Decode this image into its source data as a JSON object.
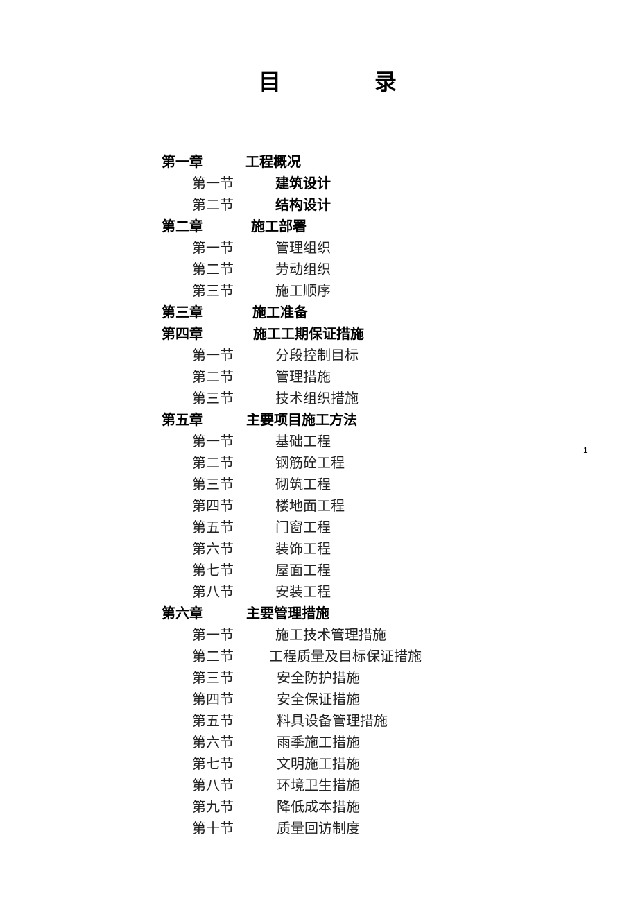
{
  "title": {
    "char1": "目",
    "char2": "录"
  },
  "page_number": "1",
  "toc": [
    {
      "type": "chapter",
      "label": "第一章",
      "title": "工程概况"
    },
    {
      "type": "section",
      "label": "第一节",
      "title": "建筑设计",
      "bold": true
    },
    {
      "type": "section",
      "label": "第二节",
      "title": "结构设计",
      "bold": true
    },
    {
      "type": "chapter",
      "label": "第二章",
      "title": "施工部署"
    },
    {
      "type": "section",
      "label": "第一节",
      "title": "管理组织"
    },
    {
      "type": "section",
      "label": "第二节",
      "title": "劳动组织"
    },
    {
      "type": "section",
      "label": "第三节",
      "title": "施工顺序"
    },
    {
      "type": "chapter",
      "label": "第三章",
      "title": "施工准备"
    },
    {
      "type": "chapter",
      "label": "第四章",
      "title": "施工工期保证措施"
    },
    {
      "type": "section",
      "label": "第一节",
      "title": "分段控制目标"
    },
    {
      "type": "section",
      "label": "第二节",
      "title": "管理措施"
    },
    {
      "type": "section",
      "label": "第三节",
      "title": "技术组织措施"
    },
    {
      "type": "chapter",
      "label": "第五章",
      "title": "主要项目施工方法"
    },
    {
      "type": "section",
      "label": "第一节",
      "title": "基础工程"
    },
    {
      "type": "section",
      "label": "第二节",
      "title": "钢筋砼工程"
    },
    {
      "type": "section",
      "label": "第三节",
      "title": "砌筑工程"
    },
    {
      "type": "section",
      "label": "第四节",
      "title": "楼地面工程"
    },
    {
      "type": "section",
      "label": "第五节",
      "title": "门窗工程"
    },
    {
      "type": "section",
      "label": "第六节",
      "title": "装饰工程"
    },
    {
      "type": "section",
      "label": "第七节",
      "title": "屋面工程"
    },
    {
      "type": "section",
      "label": "第八节",
      "title": "安装工程"
    },
    {
      "type": "chapter",
      "label": "第六章",
      "title": "主要管理措施"
    },
    {
      "type": "section",
      "label": "第一节",
      "title": "施工技术管理措施"
    },
    {
      "type": "section",
      "label": "第二节",
      "title": "工程质量及目标保证措施"
    },
    {
      "type": "section",
      "label": "第三节",
      "title": "安全防护措施"
    },
    {
      "type": "section",
      "label": "第四节",
      "title": "安全保证措施"
    },
    {
      "type": "section",
      "label": "第五节",
      "title": "料具设备管理措施"
    },
    {
      "type": "section",
      "label": "第六节",
      "title": "雨季施工措施"
    },
    {
      "type": "section",
      "label": "第七节",
      "title": "文明施工措施"
    },
    {
      "type": "section",
      "label": "第八节",
      "title": "环境卫生措施"
    },
    {
      "type": "section",
      "label": "第九节",
      "title": "降低成本措施"
    },
    {
      "type": "section",
      "label": "第十节",
      "title": "质量回访制度"
    }
  ]
}
